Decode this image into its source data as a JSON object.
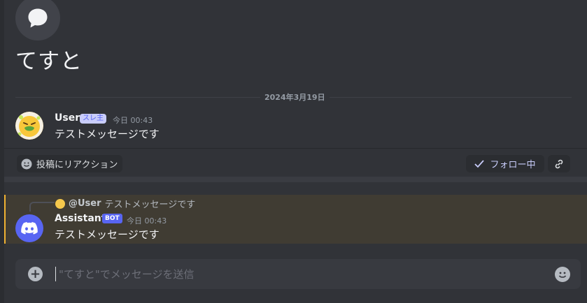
{
  "thread": {
    "title": "てすと",
    "icon": "speech-bubble-icon"
  },
  "divider": {
    "date": "2024年3月19日"
  },
  "messages": [
    {
      "author": "User",
      "tag": "スレ主",
      "time": "今日 00:43",
      "text": "テストメッセージです",
      "avatar": "nauseated-emoji-avatar"
    },
    {
      "author": "Assistant",
      "tag": "BOT",
      "time": "今日 00:43",
      "text": "テストメッセージです",
      "avatar": "discord-logo-avatar",
      "reply": {
        "mention": "@User",
        "text": "テストメッセージです"
      }
    }
  ],
  "actions": {
    "reaction_label": "投稿にリアクション",
    "follow_label": "フォロー中"
  },
  "composer": {
    "placeholder": "\"てすと\"でメッセージを送信"
  },
  "colors": {
    "accent": "#5865f2",
    "highlight_border": "#f0b232",
    "background": "#313338"
  }
}
